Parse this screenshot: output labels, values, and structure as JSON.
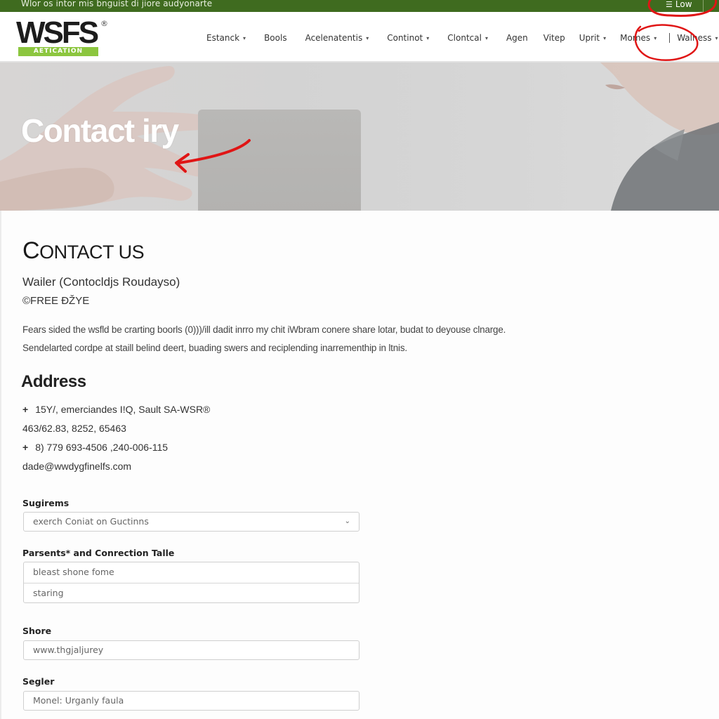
{
  "topbar": {
    "message": "Wlor os intor mis bnguist di jiore audyonarte",
    "login_icon": "list-icon",
    "login_label": "Low"
  },
  "header": {
    "logo": {
      "wordmark": "WSFS",
      "registered": "®",
      "tagline": "AETICATION"
    },
    "nav": [
      {
        "label": "Estanck",
        "has_dropdown": true
      },
      {
        "label": "Bools",
        "has_dropdown": false
      },
      {
        "label": "Acelenatentis",
        "has_dropdown": true
      },
      {
        "label": "Continot",
        "has_dropdown": true
      },
      {
        "label": "Clontcal",
        "has_dropdown": true
      },
      {
        "label": "Agen",
        "has_dropdown": false
      },
      {
        "label": "Vitep",
        "has_dropdown": false
      },
      {
        "label": "Uprit",
        "has_dropdown": true
      },
      {
        "label": "Momes",
        "has_dropdown": true
      },
      {
        "label": "Walness",
        "has_dropdown": true
      }
    ],
    "chevron_glyph": "⌄"
  },
  "hero": {
    "title": "Contact iry"
  },
  "main": {
    "heading_first": "C",
    "heading_rest": "ONTACT US",
    "subtitle": "Wailer (Contocldjs Roudayso)",
    "badge": "©FREE ÐŽYE",
    "paragraph": [
      "Fears sided the wsfld be crarting boorls (0)))/ill dadit inrro my chit iWbram conere share lotar, budat to deyouse clnarge.",
      "Sendelarted cordpe at staill belind deert, buading swers and reciplending inarrementhip in ltnis."
    ],
    "address_heading": "Address",
    "address_lines": [
      {
        "prefix": "+",
        "text": "15Y/, emerciandes I!Q, Sault SA-WSR®"
      },
      {
        "prefix": "",
        "text": "463/62.83, 8252, 65463"
      },
      {
        "prefix": "+",
        "text": "8) 779 693-4506 ,240-006-115"
      },
      {
        "prefix": "",
        "text": "dade@wwdygfinelfs.com"
      }
    ],
    "form": {
      "subject": {
        "label": "Sugirems",
        "value": "exerch Coniat on Guctinns"
      },
      "contact": {
        "label": "Parsents* and Conrection Talle",
        "rows": [
          "bleast shone fome",
          "staring"
        ]
      },
      "shore": {
        "label": "Shore",
        "value": "www.thgjaljurey"
      },
      "segler": {
        "label": "Segler",
        "value": "Monel: Urganly faula"
      }
    }
  },
  "colors": {
    "brand_green": "#3f6b1f",
    "logo_tag_green": "#8cc63f",
    "annotation_red": "#e01515"
  }
}
